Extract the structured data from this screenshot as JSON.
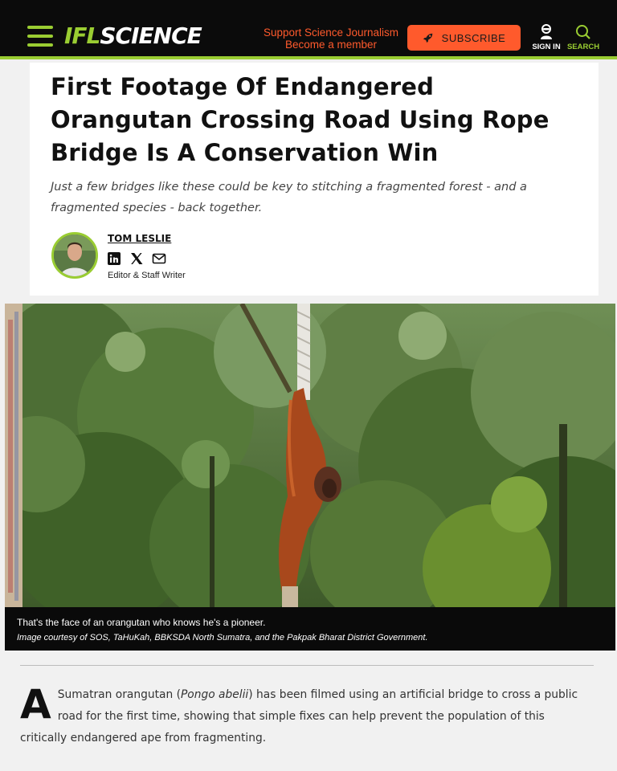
{
  "header": {
    "logo_part1": "IFL",
    "logo_part2": "SCIENCE",
    "support_line1": "Support Science Journalism",
    "support_line2": "Become a member",
    "subscribe_label": "SUBSCRIBE",
    "signin_label": "SIGN IN",
    "search_label": "SEARCH",
    "accent_color": "#9acd32",
    "cta_color": "#ff5a2c"
  },
  "article": {
    "title": "First Footage Of Endangered Orangutan Crossing Road Using Rope Bridge Is A Conservation Win",
    "dek": "Just a few bridges like these could be key to stitching a fragmented forest - and a fragmented species - back together.",
    "author": {
      "name": "TOM LESLIE",
      "role": "Editor & Staff Writer",
      "socials": [
        "linkedin-icon",
        "x-icon",
        "mail-icon"
      ]
    },
    "image": {
      "caption_line1": "That's the face of an orangutan who knows he's a pioneer.",
      "caption_line2": "Image courtesy of SOS, TaHuKah, BBKSDA North Sumatra, and the Pakpak Bharat District Government."
    },
    "body": {
      "dropcap": "A",
      "p1_before": " Sumatran orangutan (",
      "p1_italic": "Pongo abelii",
      "p1_after": ") has been filmed using an artificial bridge to cross a public road for the first time, showing that simple fixes can help prevent the population of this critically endangered ape from fragmenting."
    }
  }
}
